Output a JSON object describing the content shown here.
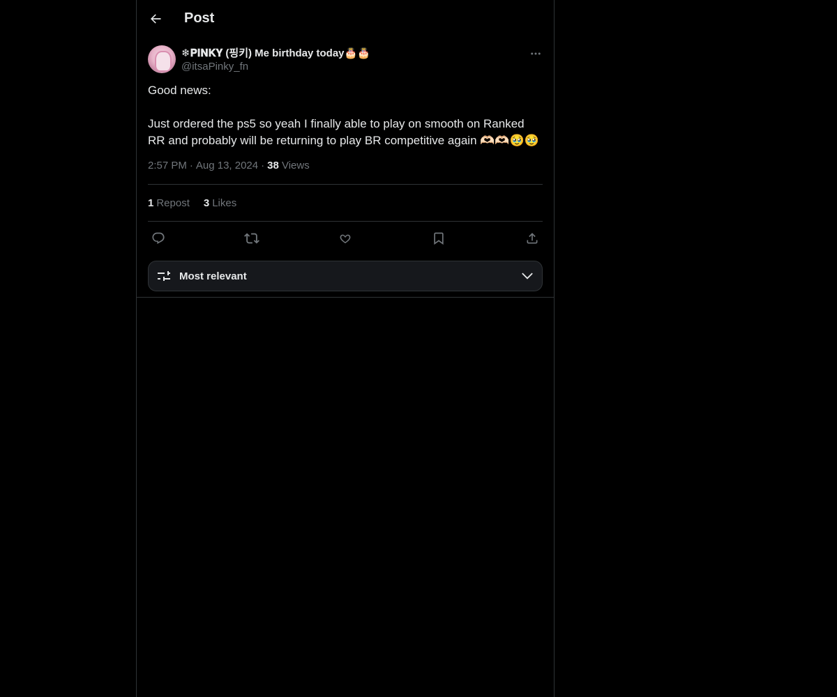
{
  "header": {
    "title": "Post",
    "back_icon": "arrow-left-icon"
  },
  "post": {
    "author": {
      "display_name": "❄𝐏𝐈𝐍𝐊𝐘 (핑키) Me birthday today🎂🎂",
      "handle": "@itsaPinky_fn"
    },
    "text": "Good news:\n\nJust ordered the ps5 so yeah I finally able to play on smooth on Ranked RR and probably will be returning to play BR competitive again 🫶🏻🫶🏻🥹🥹",
    "time": "2:57 PM",
    "date": "Aug 13, 2024",
    "views_count": "38",
    "views_label": "Views",
    "reposts_count": "1",
    "reposts_label": "Repost",
    "likes_count": "3",
    "likes_label": "Likes"
  },
  "actions": [
    "reply-icon",
    "repost-icon",
    "like-icon",
    "bookmark-icon",
    "share-icon"
  ],
  "sort": {
    "label": "Most relevant",
    "icon": "sliders-icon",
    "chevron": "chevron-down-icon"
  },
  "colors": {
    "background": "#000000",
    "text": "#e7e9ea",
    "secondary_text": "#71767b",
    "border": "#2f3336"
  }
}
